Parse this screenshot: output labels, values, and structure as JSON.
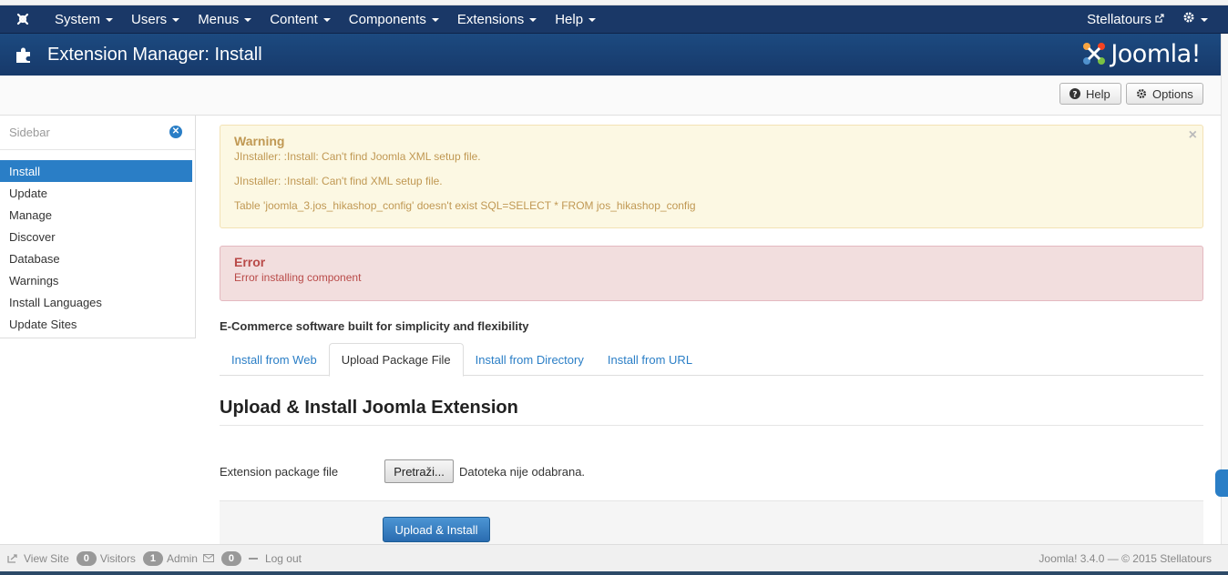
{
  "navbar": {
    "menus": [
      "System",
      "Users",
      "Menus",
      "Content",
      "Components",
      "Extensions",
      "Help"
    ],
    "site_name": "Stellatours"
  },
  "header": {
    "title": "Extension Manager: Install"
  },
  "brand": {
    "wordmark": "Joomla!"
  },
  "toolbar": {
    "help_label": "Help",
    "options_label": "Options"
  },
  "sidebar": {
    "title": "Sidebar",
    "items": [
      "Install",
      "Update",
      "Manage",
      "Discover",
      "Database",
      "Warnings",
      "Install Languages",
      "Update Sites"
    ],
    "active": "Install"
  },
  "warning": {
    "heading": "Warning",
    "messages": [
      "JInstaller: :Install: Can't find Joomla XML setup file.",
      "JInstaller: :Install: Can't find XML setup file.",
      "Table 'joomla_3.jos_hikashop_config' doesn't exist SQL=SELECT * FROM jos_hikashop_config"
    ]
  },
  "error": {
    "heading": "Error",
    "message": "Error installing component"
  },
  "tagline": "E-Commerce software built for simplicity and flexibility",
  "tabs": [
    "Install from Web",
    "Upload Package File",
    "Install from Directory",
    "Install from URL"
  ],
  "active_tab": "Upload Package File",
  "section": {
    "title": "Upload & Install Joomla Extension",
    "field_label": "Extension package file",
    "browse_label": "Pretraži...",
    "file_status": "Datoteka nije odabrana.",
    "submit_label": "Upload & Install"
  },
  "status": {
    "view_site": "View Site",
    "visitors_count": "0",
    "visitors_label": "Visitors",
    "admin_count": "1",
    "admin_label": "Admin",
    "messages_count": "0",
    "logout": "Log out",
    "copyright": "Joomla! 3.4.0 — © 2015 Stellatours"
  },
  "colors": {
    "navbar": "#1a3867",
    "accent": "#2a7ec6",
    "warning_bg": "#fcf8e3",
    "error_bg": "#f2dede"
  }
}
